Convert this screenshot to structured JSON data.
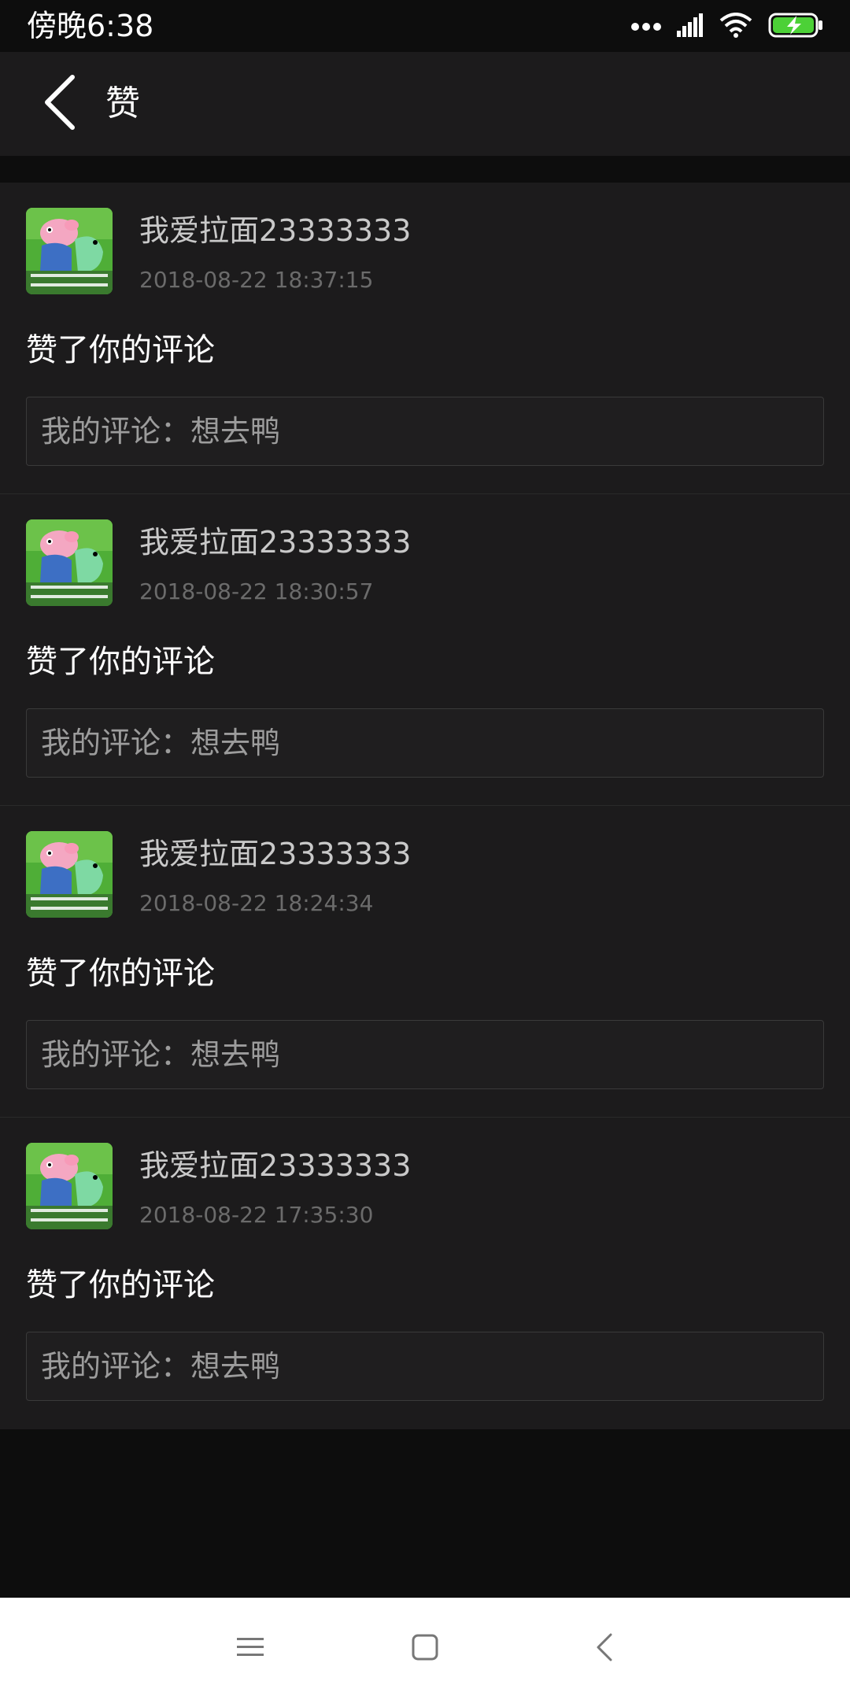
{
  "status_bar": {
    "time": "傍晚6:38",
    "icons": [
      "more-dots-icon",
      "signal-icon",
      "wifi-icon",
      "battery-charging-icon"
    ],
    "battery_color": "#4cd137"
  },
  "header": {
    "title": "赞",
    "back_icon": "chevron-left-icon"
  },
  "notifications": [
    {
      "username": "我爱拉面23333333",
      "timestamp": "2018-08-22 18:37:15",
      "action": "赞了你的评论",
      "comment": "我的评论：想去鸭"
    },
    {
      "username": "我爱拉面23333333",
      "timestamp": "2018-08-22 18:30:57",
      "action": "赞了你的评论",
      "comment": "我的评论：想去鸭"
    },
    {
      "username": "我爱拉面23333333",
      "timestamp": "2018-08-22 18:24:34",
      "action": "赞了你的评论",
      "comment": "我的评论：想去鸭"
    },
    {
      "username": "我爱拉面23333333",
      "timestamp": "2018-08-22 17:35:30",
      "action": "赞了你的评论",
      "comment": "我的评论：想去鸭"
    }
  ],
  "nav_bar": {
    "icons": [
      "menu-icon",
      "home-square-icon",
      "back-triangle-icon"
    ]
  },
  "colors": {
    "background": "#0d0d0d",
    "surface": "#1c1b1c",
    "text_primary": "#ffffff",
    "text_secondary": "#c9c9c9",
    "text_muted": "#6b6b6b"
  }
}
